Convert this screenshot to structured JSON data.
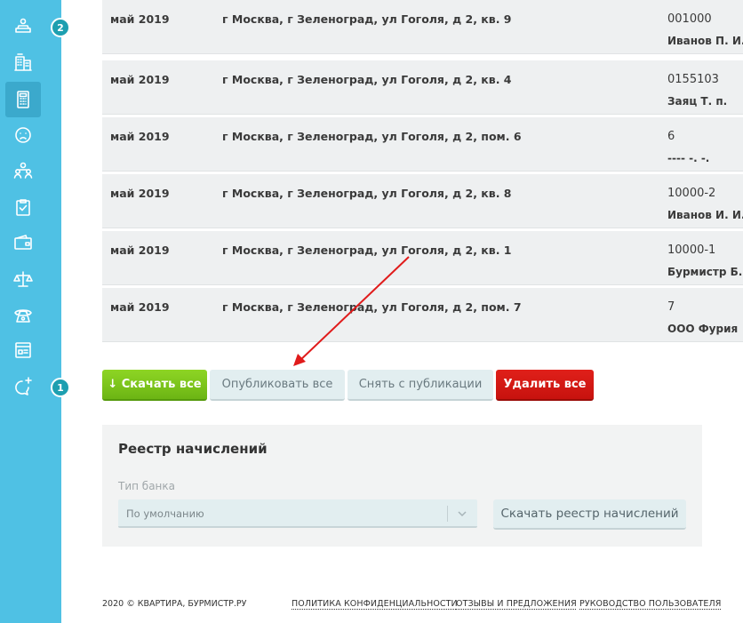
{
  "sidebar": {
    "items": [
      {
        "icon": "tray-user-icon",
        "badge": "2"
      },
      {
        "icon": "buildings-icon",
        "badge": ""
      },
      {
        "icon": "calculator-icon",
        "badge": "",
        "active": true
      },
      {
        "icon": "sad-face-icon",
        "badge": ""
      },
      {
        "icon": "users-icon",
        "badge": ""
      },
      {
        "icon": "clipboard-check-icon",
        "badge": ""
      },
      {
        "icon": "wallet-icon",
        "badge": ""
      },
      {
        "icon": "scales-icon",
        "badge": ""
      },
      {
        "icon": "phone-icon",
        "badge": ""
      },
      {
        "icon": "news-icon",
        "badge": ""
      },
      {
        "icon": "chat-plus-icon",
        "badge": "1"
      }
    ]
  },
  "rows": [
    {
      "date": "май 2019",
      "address": "г Москва, г Зеленоград, ул Гоголя, д 2, кв. 9",
      "account": "001000",
      "owner": "Иванов П. И."
    },
    {
      "date": "май 2019",
      "address": "г Москва, г Зеленоград, ул Гоголя, д 2, кв. 4",
      "account": "0155103",
      "owner": "Заяц Т. п."
    },
    {
      "date": "май 2019",
      "address": "г Москва, г Зеленоград, ул Гоголя, д 2, пом. 6",
      "account": "6",
      "owner": "---- -. -."
    },
    {
      "date": "май 2019",
      "address": "г Москва, г Зеленоград, ул Гоголя, д 2, кв. 8",
      "account": "10000-2",
      "owner": "Иванов И. И."
    },
    {
      "date": "май 2019",
      "address": "г Москва, г Зеленоград, ул Гоголя, д 2, кв. 1",
      "account": "10000-1",
      "owner": "Бурмистр Б. Б."
    },
    {
      "date": "май 2019",
      "address": "г Москва, г Зеленоград, ул Гоголя, д 2, пом. 7",
      "account": "7",
      "owner": "ООО Фурия"
    }
  ],
  "actions": {
    "download_all": "↓ Скачать все",
    "publish_all": "Опубликовать все",
    "unpublish": "Снять с публикации",
    "delete_all": "Удалить все"
  },
  "register": {
    "title": "Реестр начислений",
    "bank_type_label": "Тип банка",
    "bank_type_value": "По умолчанию",
    "download_button": "Скачать реестр начислений"
  },
  "footer": {
    "copyright": "2020 © КВАРТИРА, БУРМИСТР.РУ",
    "privacy": "ПОЛИТИКА КОНФИДЕНЦИАЛЬНОСТИ",
    "feedback": "ОТЗЫВЫ И ПРЕДЛОЖЕНИЯ",
    "guide": "РУКОВОДСТВО ПОЛЬЗОВАТЕЛЯ"
  },
  "colors": {
    "sidebar": "#4fc1e4",
    "download": "#7cc51c",
    "delete": "#d4170f",
    "annotation": "#e01b1b"
  }
}
